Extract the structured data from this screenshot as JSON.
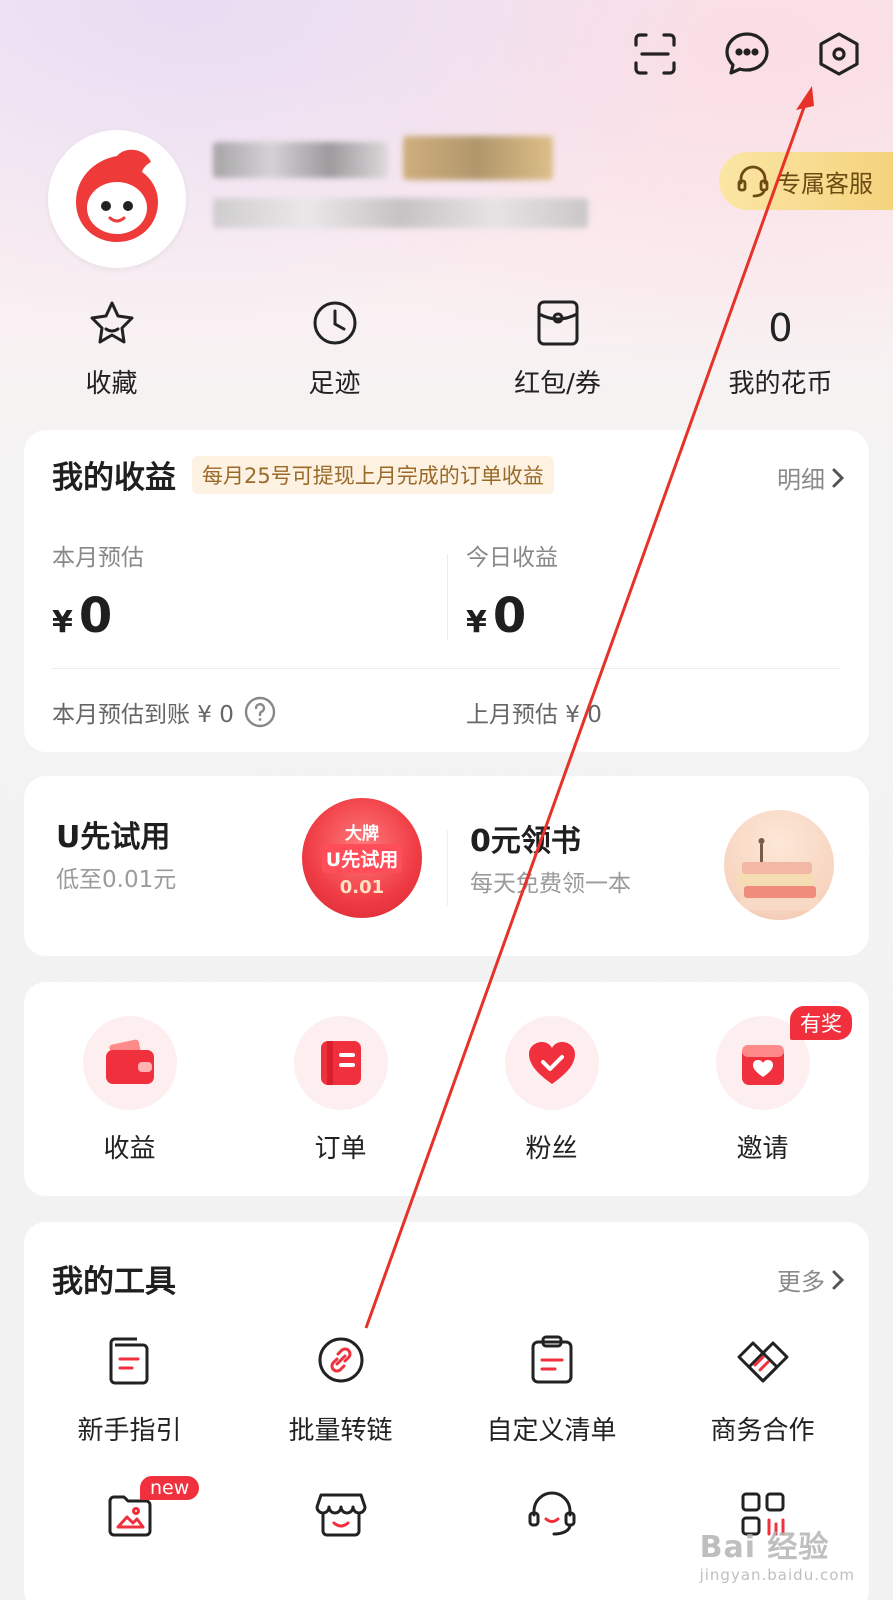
{
  "colors": {
    "accent": "#f0303d",
    "service_bg": "#f5d37d",
    "annotation_arrow": "#e63228"
  },
  "header": {
    "icons": [
      "scan-icon",
      "message-icon",
      "settings-icon"
    ],
    "service_label": "专属客服"
  },
  "quick_links": [
    {
      "label": "收藏",
      "icon": "star-icon"
    },
    {
      "label": "足迹",
      "icon": "clock-icon"
    },
    {
      "label": "红包/券",
      "icon": "coupon-icon"
    },
    {
      "label": "我的花币",
      "value": "0"
    }
  ],
  "earnings": {
    "title": "我的收益",
    "tip": "每月25号可提现上月完成的订单收益",
    "detail_label": "明细",
    "month_label": "本月预估",
    "month_currency": "¥",
    "month_value": "0",
    "today_label": "今日收益",
    "today_currency": "¥",
    "today_value": "0",
    "arrival_text": "本月预估到账 ¥ 0",
    "last_month_text": "上月预估 ¥ 0"
  },
  "promos": [
    {
      "title": "U先试用",
      "subtitle": "低至0.01元",
      "badge_line1": "大牌",
      "badge_line2": "U先试用",
      "badge_line3": "0.01"
    },
    {
      "title": "0元领书",
      "subtitle": "每天免费领一本"
    }
  ],
  "entries": [
    {
      "label": "收益",
      "icon": "wallet-icon"
    },
    {
      "label": "订单",
      "icon": "order-icon"
    },
    {
      "label": "粉丝",
      "icon": "heart-check-icon"
    },
    {
      "label": "邀请",
      "icon": "invite-icon",
      "badge": "有奖"
    }
  ],
  "tools": {
    "title": "我的工具",
    "more_label": "更多",
    "row1": [
      {
        "label": "新手指引",
        "icon": "guide-icon"
      },
      {
        "label": "批量转链",
        "icon": "link-icon"
      },
      {
        "label": "自定义清单",
        "icon": "clipboard-icon"
      },
      {
        "label": "商务合作",
        "icon": "handshake-icon"
      }
    ],
    "row2": [
      {
        "icon": "image-icon",
        "badge": "new"
      },
      {
        "icon": "store-icon"
      },
      {
        "icon": "headset-icon"
      },
      {
        "icon": "qrcode-icon"
      }
    ]
  },
  "watermark": {
    "main": "Bai 经验",
    "sub": "jingyan.baidu.com"
  }
}
